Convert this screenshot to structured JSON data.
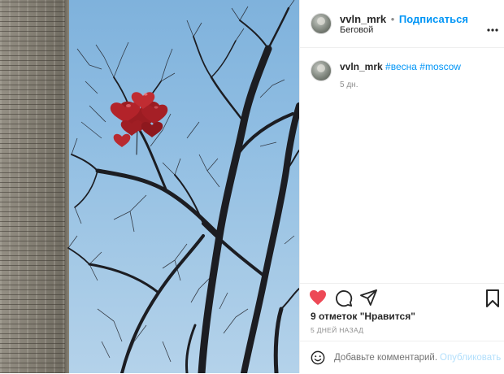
{
  "post": {
    "author": {
      "username": "vvln_mrk",
      "separator": "•",
      "follow_label": "Подписаться",
      "location": "Беговой"
    },
    "more_icon": "more-horizontal-icon",
    "caption": {
      "username": "vvln_mrk",
      "hashtags": "#весна #moscow",
      "age": "5 дн."
    },
    "likes_label": "9 отметок \"Нравится\"",
    "timestamp": "5 ДНЕЙ НАЗАД",
    "comment": {
      "placeholder": "Добавьте комментарий...",
      "publish_label": "Опубликовать"
    },
    "colors": {
      "like_red": "#ed4956",
      "link_blue": "#0095f6",
      "publish_disabled": "#b2dffc"
    }
  }
}
